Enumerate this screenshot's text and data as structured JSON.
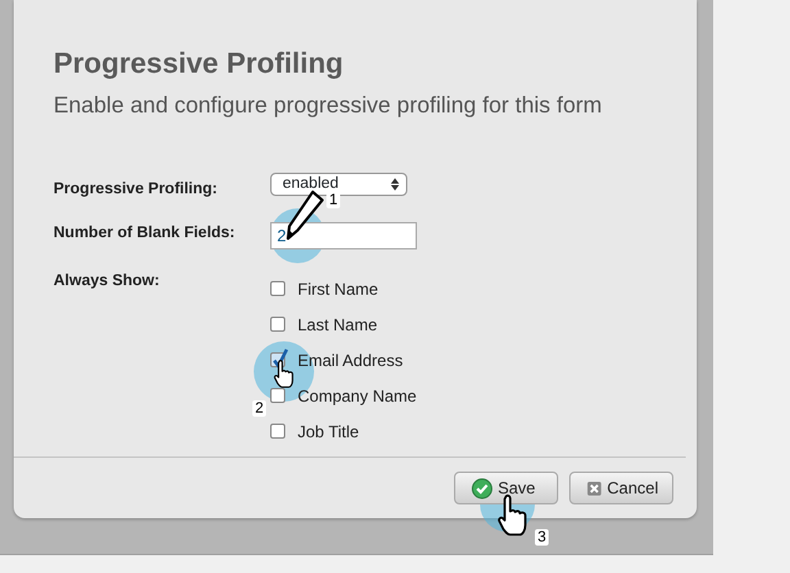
{
  "dialog": {
    "title": "Progressive Profiling",
    "subtitle": "Enable and configure progressive profiling for this form",
    "fields": [
      {
        "kind": "select",
        "label": "Progressive Profiling:",
        "value": "enabled"
      },
      {
        "kind": "text",
        "label": "Number of Blank Fields:",
        "value": "2"
      },
      {
        "kind": "checklist",
        "label": "Always Show:",
        "options": [
          {
            "label": "First Name",
            "checked": false
          },
          {
            "label": "Last Name",
            "checked": false
          },
          {
            "label": "Email Address",
            "checked": true
          },
          {
            "label": "Company Name",
            "checked": false
          },
          {
            "label": "Job Title",
            "checked": false
          }
        ]
      }
    ],
    "buttons": [
      {
        "kind": "save",
        "label": "Save"
      },
      {
        "kind": "cancel",
        "label": "Cancel"
      }
    ]
  },
  "annotations": [
    {
      "kind": "pencil",
      "number": "1"
    },
    {
      "kind": "hand",
      "number": "2"
    },
    {
      "kind": "hand",
      "number": "3"
    }
  ]
}
